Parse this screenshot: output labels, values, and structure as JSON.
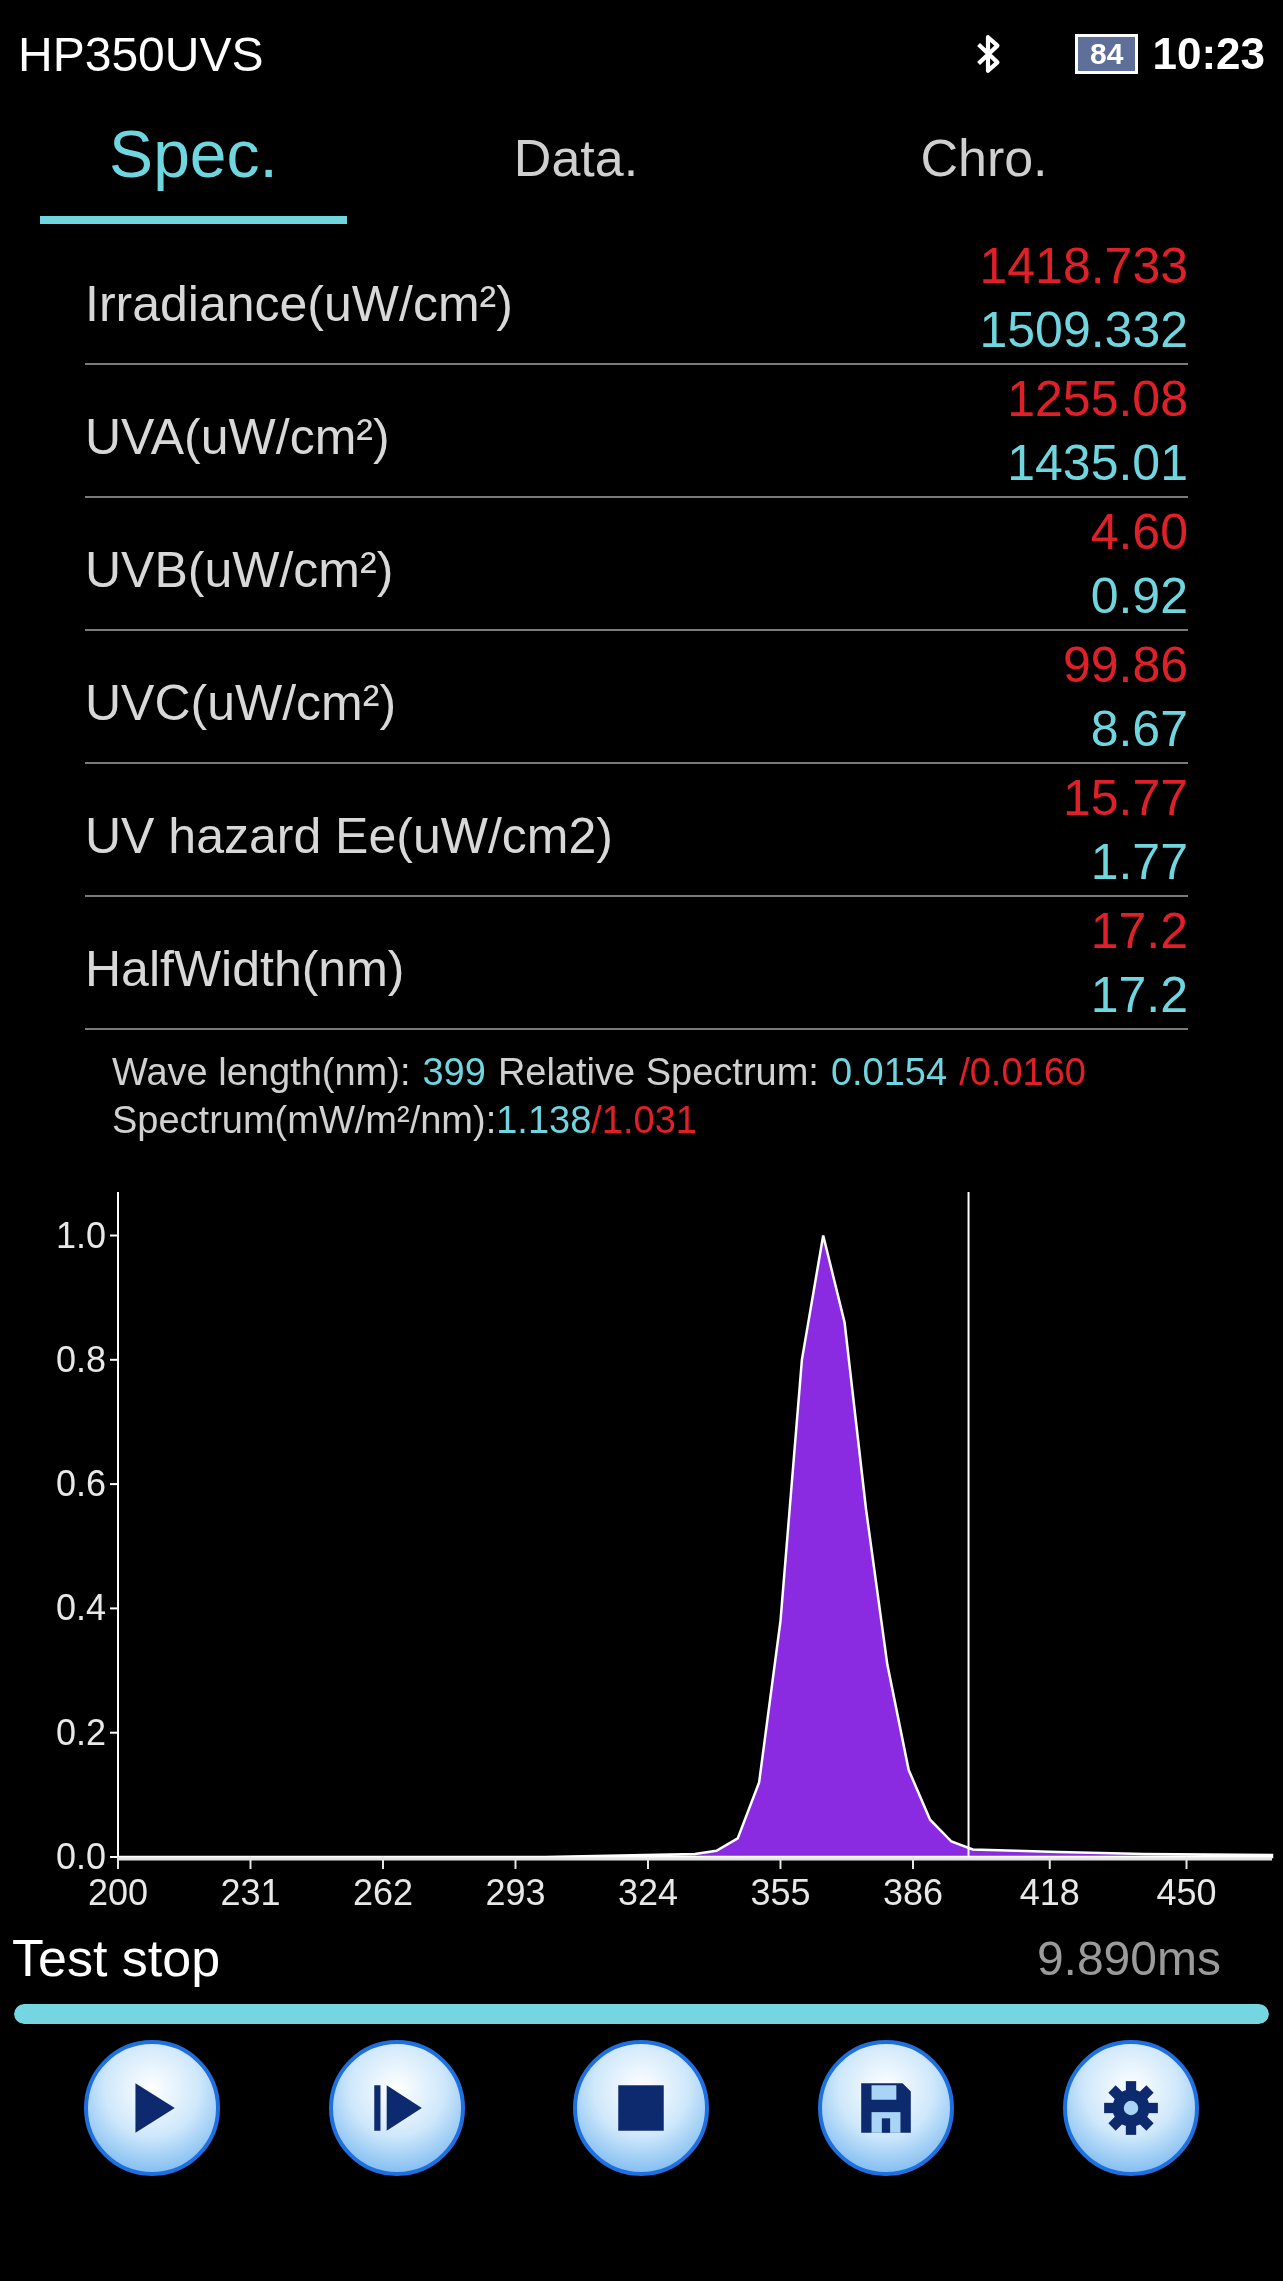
{
  "status_bar": {
    "title": "HP350UVS",
    "battery": "84",
    "time": "10:23"
  },
  "tabs": [
    {
      "label": "Spec.",
      "selected": true
    },
    {
      "label": "Data.",
      "selected": false
    },
    {
      "label": "Chro.",
      "selected": false
    }
  ],
  "readings": [
    {
      "label": "Irradiance(uW/cm²)",
      "upper": "1418.733",
      "lower": "1509.332"
    },
    {
      "label": "UVA(uW/cm²)",
      "upper": "1255.08",
      "lower": "1435.01"
    },
    {
      "label": "UVB(uW/cm²)",
      "upper": "4.60",
      "lower": "0.92"
    },
    {
      "label": "UVC(uW/cm²)",
      "upper": "99.86",
      "lower": "8.67"
    },
    {
      "label": "UV hazard Ee(uW/cm2)",
      "upper": "15.77",
      "lower": "1.77"
    },
    {
      "label": "HalfWidth(nm)",
      "upper": "17.2",
      "lower": "17.2"
    }
  ],
  "cursor_info": [
    [
      {
        "text": "Wave length(nm):",
        "color": "#d0d0d0"
      },
      {
        "text": "399",
        "color": "#6fd6e0"
      },
      {
        "text": "Relative Spectrum:",
        "color": "#d0d0d0"
      },
      {
        "text": "0.0154",
        "color": "#6fd6e0"
      },
      {
        "text": "/0.0160",
        "color": "#e02028"
      }
    ],
    [
      {
        "text": "Spectrum(mW/m²/nm):",
        "color": "#d0d0d0"
      },
      {
        "text": "1.138",
        "color": "#6fd6e0"
      },
      {
        "text": "/1.031",
        "color": "#e02028"
      }
    ]
  ],
  "chart_data": {
    "type": "area",
    "x": [
      200,
      300,
      335,
      340,
      345,
      350,
      355,
      360,
      365,
      370,
      375,
      380,
      385,
      390,
      395,
      400,
      410,
      420,
      440,
      470
    ],
    "series": [
      {
        "color": "#8a2be2",
        "values": [
          0,
          0,
          0.005,
          0.01,
          0.03,
          0.12,
          0.38,
          0.8,
          1.0,
          0.86,
          0.56,
          0.31,
          0.14,
          0.06,
          0.025,
          0.012,
          0.01,
          0.008,
          0.005,
          0.003
        ]
      }
    ],
    "xlim": [
      200,
      470
    ],
    "ylim": [
      0,
      1.07
    ],
    "xticks": [
      200,
      231,
      262,
      293,
      324,
      355,
      386,
      418,
      450
    ],
    "yticks": [
      {
        "value": 0,
        "label": "0.0"
      },
      {
        "value": 0.2,
        "label": "0.2"
      },
      {
        "value": 0.4,
        "label": "0.4"
      },
      {
        "value": 0.6,
        "label": "0.6"
      },
      {
        "value": 0.8,
        "label": "0.8"
      },
      {
        "value": 1,
        "label": "1.0"
      }
    ],
    "ref_lines": [
      {
        "axis": "x",
        "value": 399
      }
    ]
  },
  "status": {
    "label": "Test stop",
    "time": "9.890ms"
  },
  "progress": {
    "level": 1
  },
  "buttons": [
    {
      "kind": "play"
    },
    {
      "kind": "step"
    },
    {
      "kind": "stop"
    },
    {
      "kind": "save"
    },
    {
      "kind": "settings"
    }
  ]
}
